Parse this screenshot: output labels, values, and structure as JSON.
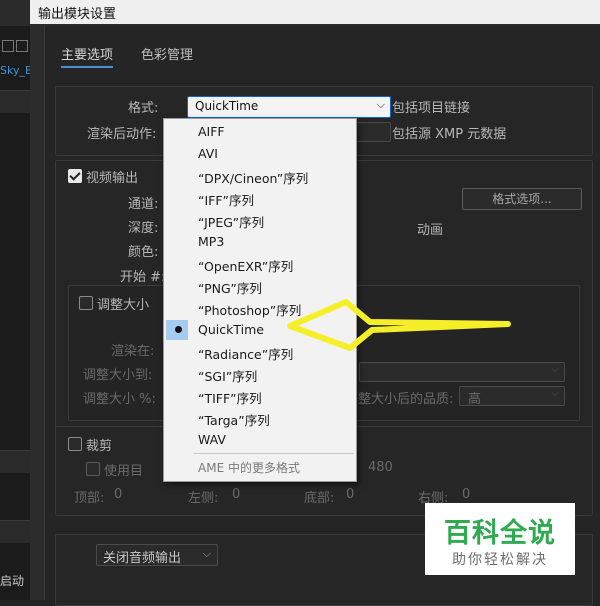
{
  "background_app": {
    "sky_label": "Sky_B",
    "bottom_label": "启动"
  },
  "dialog": {
    "title": "输出模块设置",
    "tabs": [
      {
        "label": "主要选项",
        "active": true
      },
      {
        "label": "色彩管理",
        "active": false
      }
    ],
    "format": {
      "label": "格式:",
      "value": "QuickTime",
      "include_project_link": "包括项目链接",
      "post_render_label": "渲染后动作:",
      "include_xmp": "包括源 XMP 元数据"
    },
    "video": {
      "checkbox_label": "视频输出",
      "checked": true,
      "channels_label": "通道:",
      "depth_label": "深度:",
      "color_label": "颜色:",
      "start_label": "开始 #:",
      "format_options_button": "格式选项...",
      "motion_fragment": "动画"
    },
    "resize": {
      "checkbox_label": "调整大小",
      "render_at": "渲染在:",
      "resize_to": "调整大小到:",
      "resize_percent": "调整大小 %:",
      "quality_label": "调整大小后的品质:",
      "quality_value": "高"
    },
    "crop": {
      "checkbox_label": "裁剪",
      "use_label": "使用目",
      "value_480": "480",
      "top": "顶部:",
      "top_value": "0",
      "left": "左侧:",
      "left_value": "0",
      "bottom": "底部:",
      "bottom_value": "0",
      "right": "右侧:",
      "right_value": "0"
    },
    "audio": {
      "select_value": "关闭音频输出"
    }
  },
  "format_menu": {
    "items": [
      {
        "label": "AIFF",
        "selected": false
      },
      {
        "label": "AVI",
        "selected": false
      },
      {
        "label": "“DPX/Cineon”序列",
        "selected": false
      },
      {
        "label": "“IFF”序列",
        "selected": false
      },
      {
        "label": "“JPEG”序列",
        "selected": false
      },
      {
        "label": "MP3",
        "selected": false
      },
      {
        "label": "“OpenEXR”序列",
        "selected": false
      },
      {
        "label": "“PNG”序列",
        "selected": false
      },
      {
        "label": "“Photoshop”序列",
        "selected": false
      },
      {
        "label": "QuickTime",
        "selected": true
      },
      {
        "label": "“Radiance”序列",
        "selected": false
      },
      {
        "label": "“SGI”序列",
        "selected": false
      },
      {
        "label": "“TIFF”序列",
        "selected": false
      },
      {
        "label": "“Targa”序列",
        "selected": false
      },
      {
        "label": "WAV",
        "selected": false
      }
    ],
    "more": "AME 中的更多格式"
  },
  "watermark": {
    "title": "百科全说",
    "subtitle": "助你轻松解决"
  },
  "colors": {
    "arrow": "#f5ef2a",
    "selection": "#a7cbef",
    "accent": "#4a8fd6",
    "watermark_green": "#2eaa4f"
  }
}
